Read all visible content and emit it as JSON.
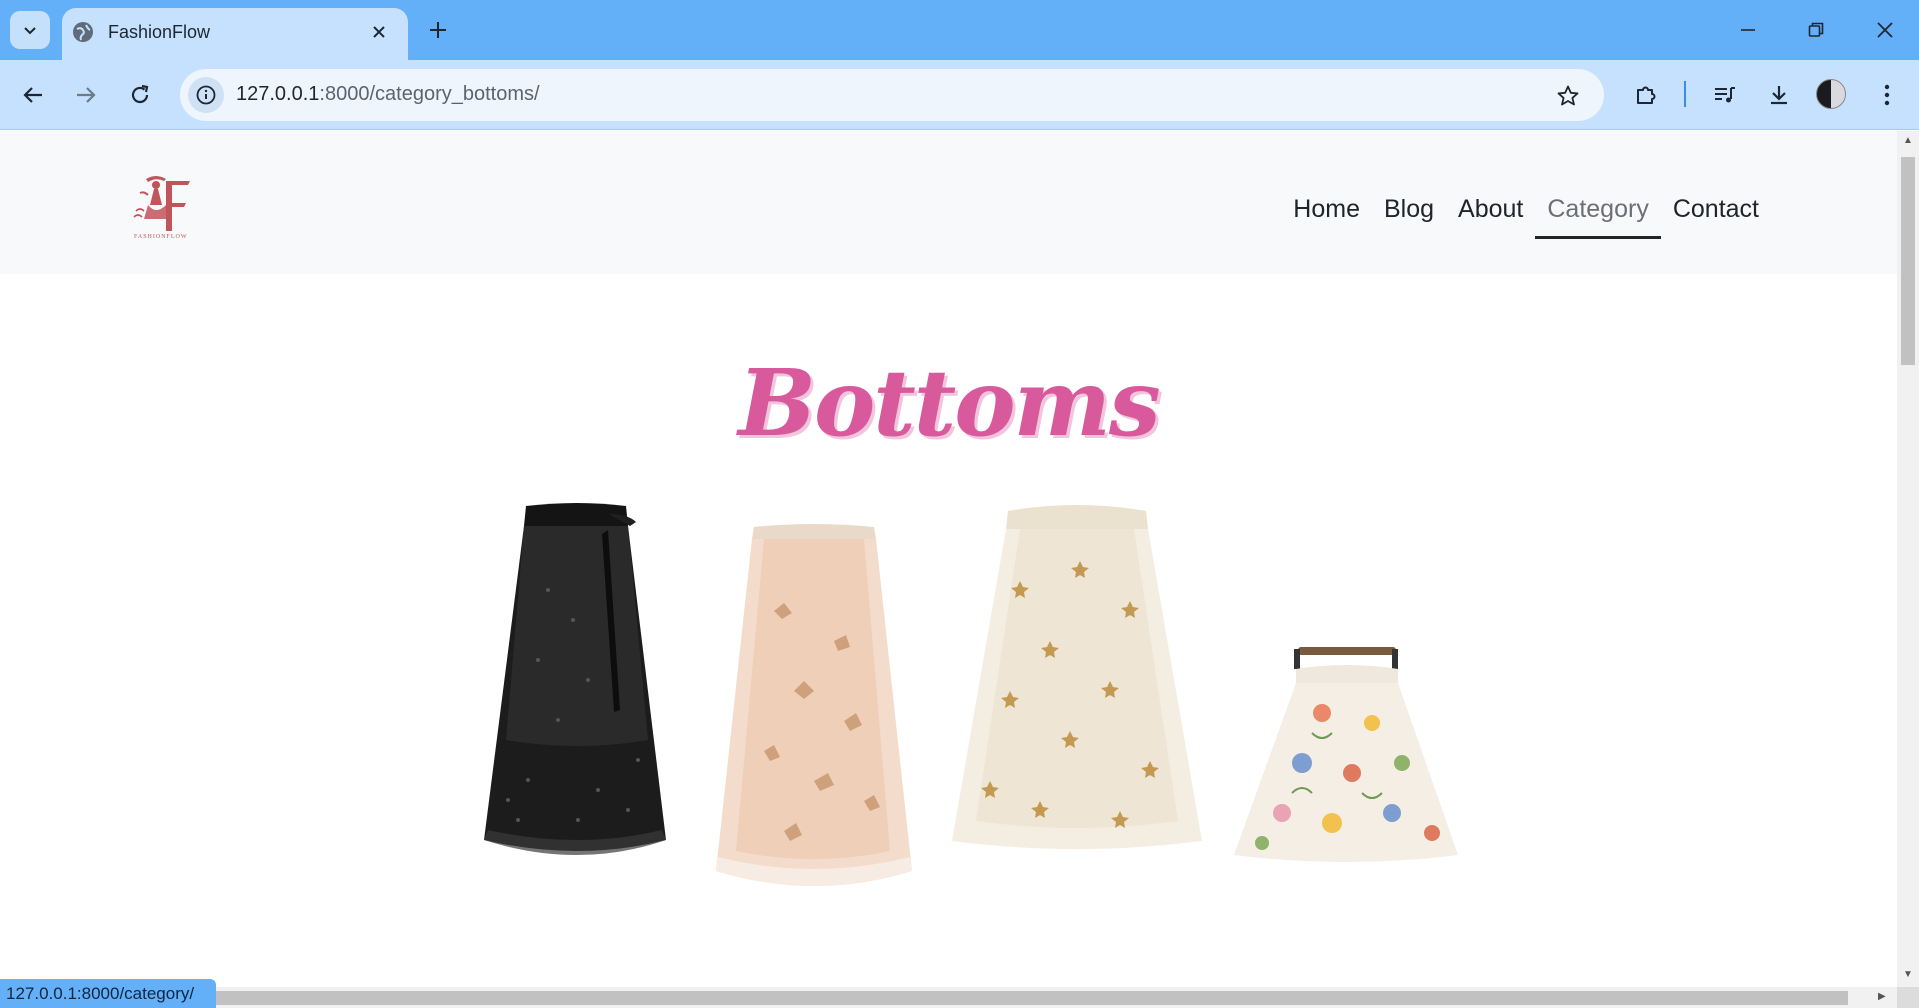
{
  "browser": {
    "tab": {
      "title": "FashionFlow",
      "favicon": "globe-icon"
    },
    "url": {
      "host": "127.0.0.1",
      "path": ":8000/category_bottoms/"
    },
    "status_text": "127.0.0.1:8000/category/"
  },
  "site": {
    "logo_text": "FASHIONFLOW",
    "nav": [
      {
        "label": "Home"
      },
      {
        "label": "Blog"
      },
      {
        "label": "About"
      },
      {
        "label": "Category",
        "active": true
      },
      {
        "label": "Contact"
      }
    ],
    "page_title": "Bottoms",
    "products": [
      {
        "name": "black-tulle-skirt",
        "colors": [
          "#1a1a1a",
          "#2e2e2e"
        ]
      },
      {
        "name": "blush-floral-tulle-skirt",
        "colors": [
          "#f2d7c4",
          "#d9a88a"
        ]
      },
      {
        "name": "cream-star-tulle-skirt",
        "colors": [
          "#f3ece0",
          "#c9a567"
        ]
      },
      {
        "name": "floral-print-maxi-skirt",
        "colors": [
          "#f3eee6",
          "#e07a5f"
        ]
      }
    ]
  },
  "colors": {
    "tabstrip": "#63aff8",
    "toolbar": "#c6e1fd",
    "title_pink": "#d85a9c"
  }
}
